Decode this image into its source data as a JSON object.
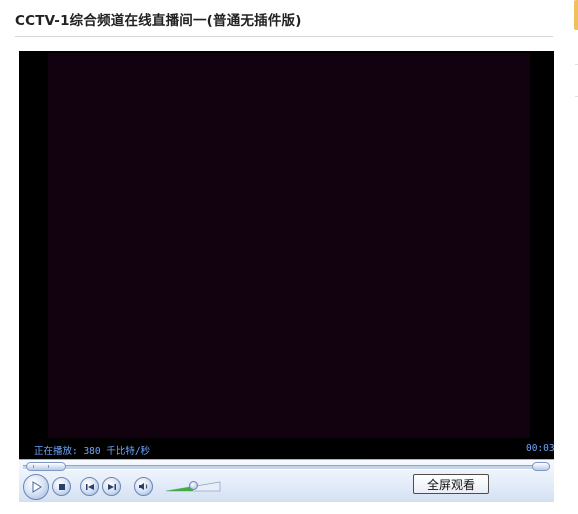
{
  "page": {
    "title": "CCTV-1综合频道在线直播间一(普通无插件版)"
  },
  "player": {
    "status_text": "正在播放: 380 千比特/秒",
    "time_text": "00:03",
    "seek_position": 0,
    "volume_level": 0.5,
    "fullscreen_label": "全屏观看",
    "colors": {
      "video_background": "#12010f",
      "status_text": "#6fa6ff",
      "volume_fill": "#3fae3f"
    },
    "icons": {
      "play": "play-icon",
      "stop": "stop-icon",
      "prev": "skip-back-icon",
      "next": "skip-forward-icon",
      "mute": "speaker-icon"
    }
  }
}
